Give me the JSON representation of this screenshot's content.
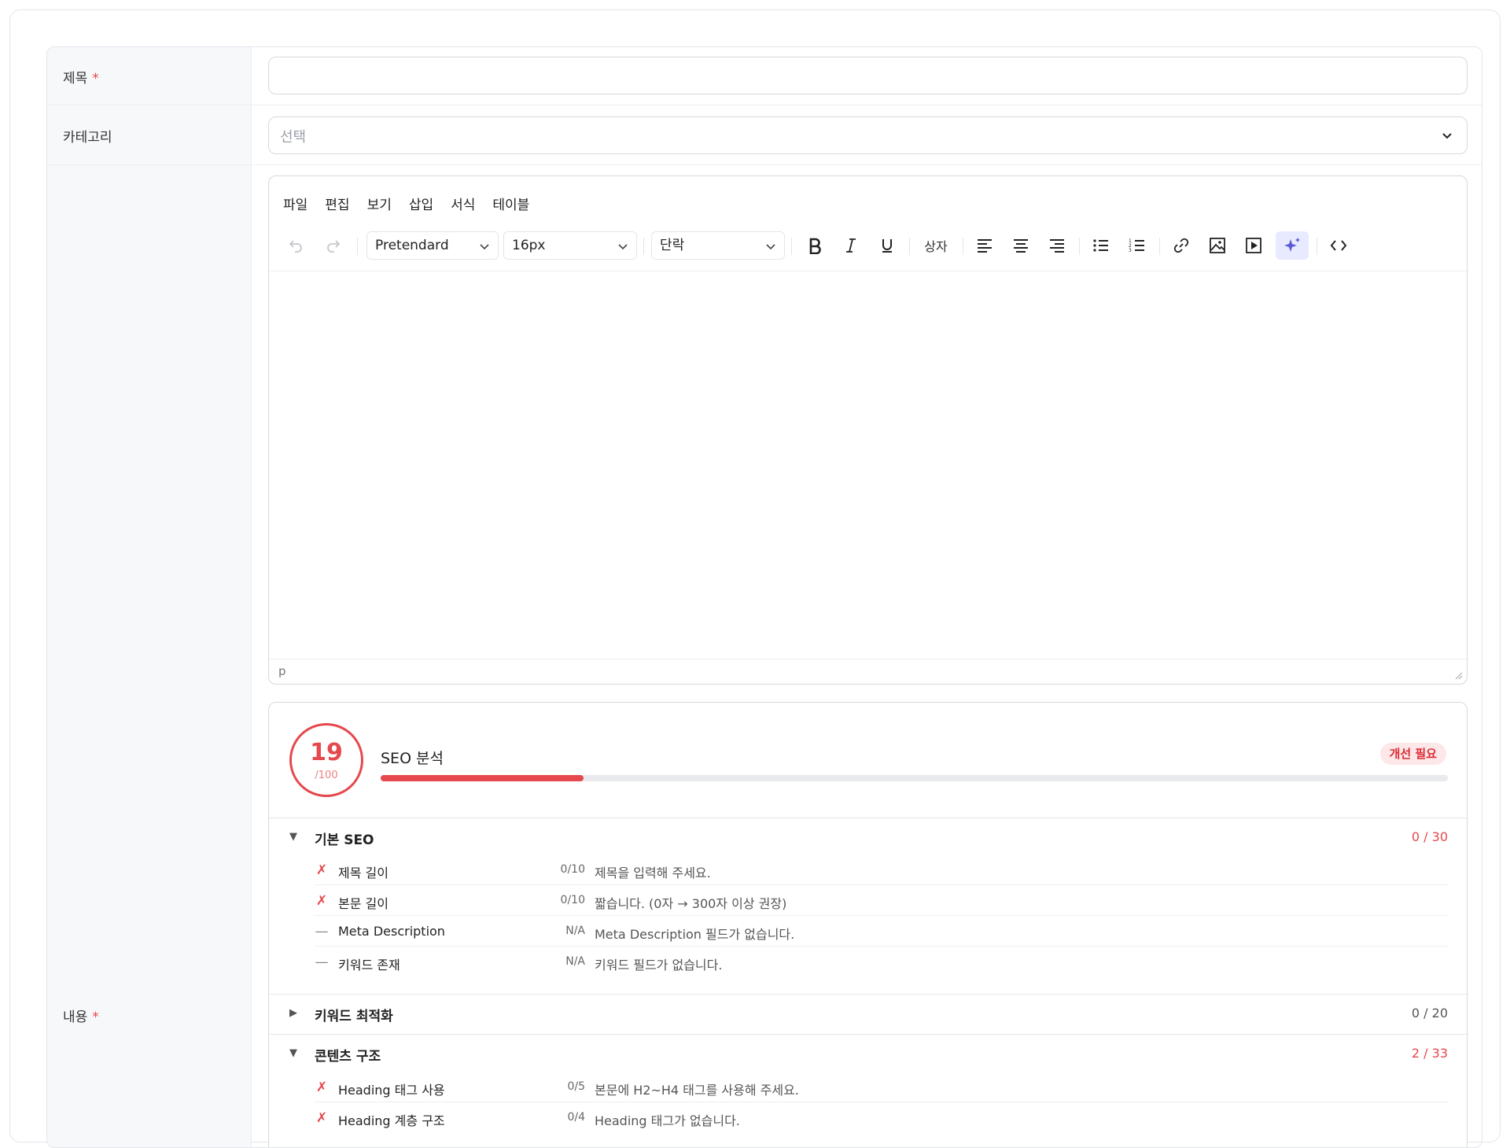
{
  "form": {
    "title_label": "제목",
    "title_required": "*",
    "title_value": "",
    "category_label": "카테고리",
    "category_placeholder": "선택",
    "content_label": "내용",
    "content_required": "*"
  },
  "editor": {
    "menu": [
      "파일",
      "편집",
      "보기",
      "삽입",
      "서식",
      "테이블"
    ],
    "font_family": "Pretendard",
    "font_size": "16px",
    "block_format": "단락",
    "box_label": "상자",
    "status_path": "p"
  },
  "seo": {
    "score": "19",
    "score_max": "/100",
    "score_fraction": 0.19,
    "title": "SEO 분석",
    "badge": "개선 필요",
    "colors": {
      "fail": "#e5484d",
      "accent": "#5b5bd6"
    },
    "sections": [
      {
        "title": "기본 SEO",
        "score": "0 / 30",
        "expanded": true,
        "items": [
          {
            "mark": "✗",
            "name": "제목 길이",
            "score": "0/10",
            "message": "제목을 입력해 주세요."
          },
          {
            "mark": "✗",
            "name": "본문 길이",
            "score": "0/10",
            "message": "짧습니다. (0자 → 300자 이상 권장)"
          },
          {
            "mark": "—",
            "name": "Meta Description",
            "score": "N/A",
            "message": "Meta Description 필드가 없습니다."
          },
          {
            "mark": "—",
            "name": "키워드 존재",
            "score": "N/A",
            "message": "키워드 필드가 없습니다."
          }
        ]
      },
      {
        "title": "키워드 최적화",
        "score": "0 / 20",
        "expanded": false,
        "items": []
      },
      {
        "title": "콘텐츠 구조",
        "score": "2 / 33",
        "expanded": true,
        "items": [
          {
            "mark": "✗",
            "name": "Heading 태그 사용",
            "score": "0/5",
            "message": "본문에 H2~H4 태그를 사용해 주세요."
          },
          {
            "mark": "✗",
            "name": "Heading 계층 구조",
            "score": "0/4",
            "message": "Heading 태그가 없습니다."
          }
        ]
      }
    ]
  }
}
